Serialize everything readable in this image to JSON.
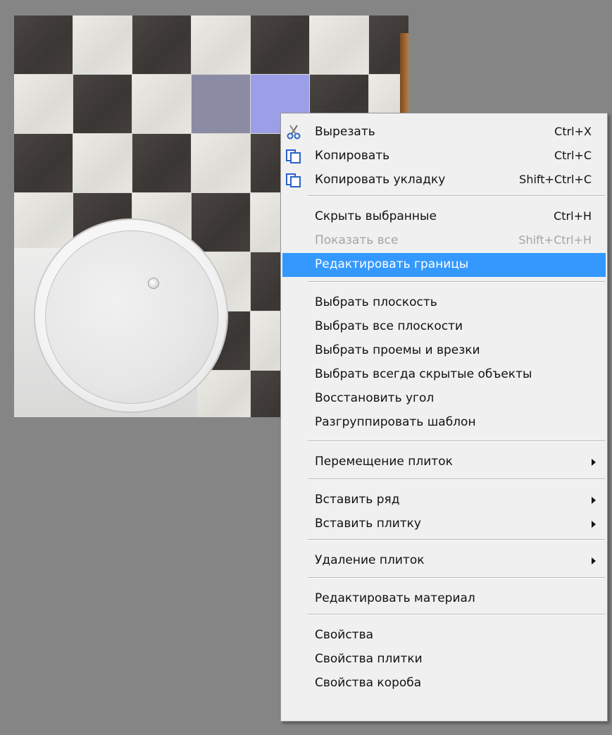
{
  "menu": {
    "items": [
      {
        "label": "Вырезать",
        "shortcut": "Ctrl+X",
        "icon": "scissors-icon"
      },
      {
        "label": "Копировать",
        "shortcut": "Ctrl+C",
        "icon": "copy-icon"
      },
      {
        "label": "Копировать укладку",
        "shortcut": "Shift+Ctrl+C",
        "icon": "copy-layout-icon"
      },
      {
        "label": "Скрыть выбранные",
        "shortcut": "Ctrl+H"
      },
      {
        "label": "Показать все",
        "shortcut": "Shift+Ctrl+H",
        "disabled": true
      },
      {
        "label": "Редактировать границы",
        "highlighted": true
      },
      {
        "label": "Выбрать плоскость"
      },
      {
        "label": "Выбрать все плоскости"
      },
      {
        "label": "Выбрать проемы и врезки"
      },
      {
        "label": "Выбрать всегда скрытые объекты"
      },
      {
        "label": "Восстановить угол"
      },
      {
        "label": "Разгруппировать шаблон"
      },
      {
        "label": "Перемещение плиток",
        "submenu": true
      },
      {
        "label": "Вставить ряд",
        "submenu": true
      },
      {
        "label": "Вставить плитку",
        "submenu": true
      },
      {
        "label": "Удаление плиток",
        "submenu": true
      },
      {
        "label": "Редактировать материал"
      },
      {
        "label": "Свойства"
      },
      {
        "label": "Свойства плитки"
      },
      {
        "label": "Свойства короба"
      }
    ]
  },
  "colors": {
    "highlight": "#3399ff",
    "menu_background": "#f0f0f0",
    "disabled_text": "#a5a5a5",
    "selected_tile_1": "#8b8ca3",
    "selected_tile_2": "#9c9ee7"
  }
}
